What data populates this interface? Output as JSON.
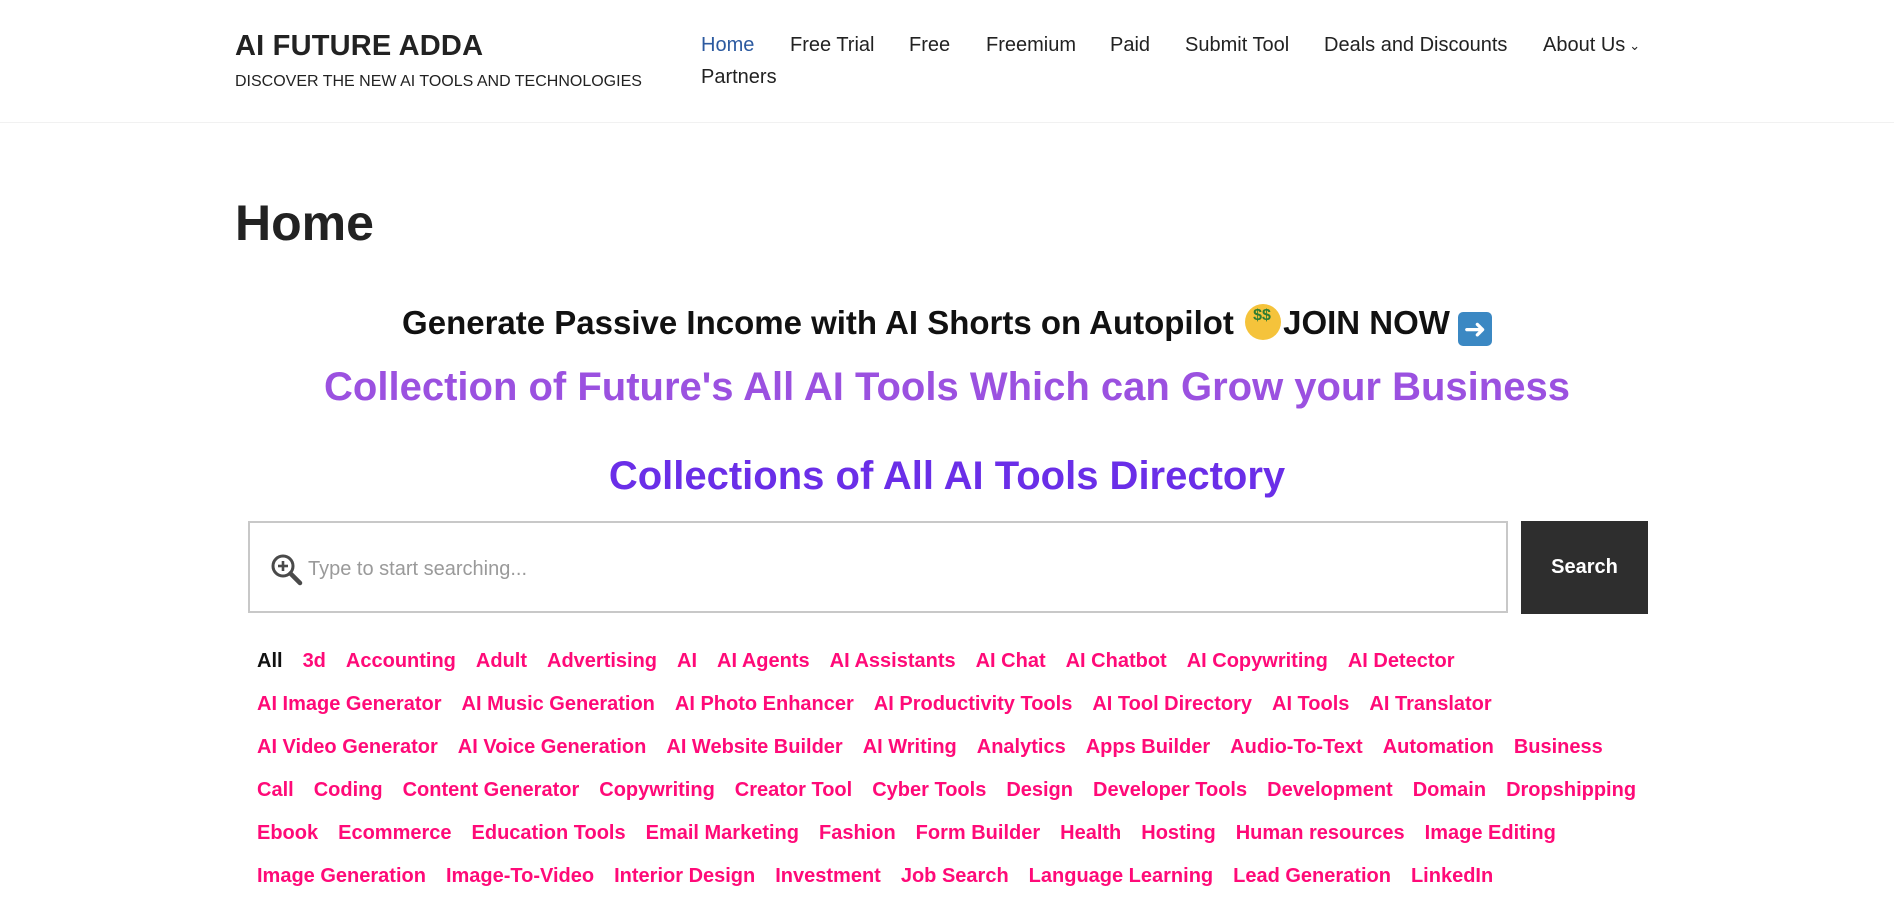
{
  "site": {
    "title": "AI FUTURE ADDA",
    "tagline": "DISCOVER THE NEW AI TOOLS AND TECHNOLOGIES"
  },
  "nav": {
    "items": [
      {
        "label": "Home",
        "active": true
      },
      {
        "label": "Free Trial"
      },
      {
        "label": "Free"
      },
      {
        "label": "Freemium"
      },
      {
        "label": "Paid"
      },
      {
        "label": "Submit Tool"
      },
      {
        "label": "Deals and Discounts"
      },
      {
        "label": "About Us",
        "has_submenu": true
      },
      {
        "label": "Partners"
      }
    ],
    "active_color": "#2c5aa0"
  },
  "page": {
    "title": "Home",
    "promo_text": "Generate Passive Income with AI Shorts on Autopilot ",
    "promo_join": "JOIN NOW",
    "promo_icons": [
      "money-mouth-face-icon",
      "right-arrow-icon"
    ],
    "headline1": "Collection of Future's All AI Tools Which can Grow your Business",
    "headline2": "Collections of All AI Tools Directory",
    "headline1_color": "#9b51e0",
    "headline2_color": "#6a2ee8"
  },
  "search": {
    "placeholder": "Type to start searching...",
    "button_label": "Search",
    "icon": "search-plus-icon"
  },
  "categories": {
    "color": "#ff0a78",
    "rows": [
      [
        "All",
        "3d",
        "Accounting",
        "Adult",
        "Advertising",
        "AI",
        "AI Agents",
        "AI Assistants",
        "AI Chat",
        "AI Chatbot",
        "AI Copywriting",
        "AI Detector"
      ],
      [
        "AI Image Generator",
        "AI Music Generation",
        "AI Photo Enhancer",
        "AI Productivity Tools",
        "AI Tool Directory",
        "AI Tools",
        "AI Translator"
      ],
      [
        "AI Video Generator",
        "AI Voice Generation",
        "AI Website Builder",
        "AI Writing",
        "Analytics",
        "Apps Builder",
        "Audio-To-Text",
        "Automation",
        "Business"
      ],
      [
        "Call",
        "Coding",
        "Content Generator",
        "Copywriting",
        "Creator Tool",
        "Cyber Tools",
        "Design",
        "Developer Tools",
        "Development",
        "Domain",
        "Dropshipping"
      ],
      [
        "Ebook",
        "Ecommerce",
        "Education Tools",
        "Email Marketing",
        "Fashion",
        "Form Builder",
        "Health",
        "Hosting",
        "Human resources",
        "Image Editing"
      ],
      [
        "Image Generation",
        "Image-To-Video",
        "Interior Design",
        "Investment",
        "Job Search",
        "Language Learning",
        "Lead Generation",
        "LinkedIn"
      ]
    ]
  }
}
